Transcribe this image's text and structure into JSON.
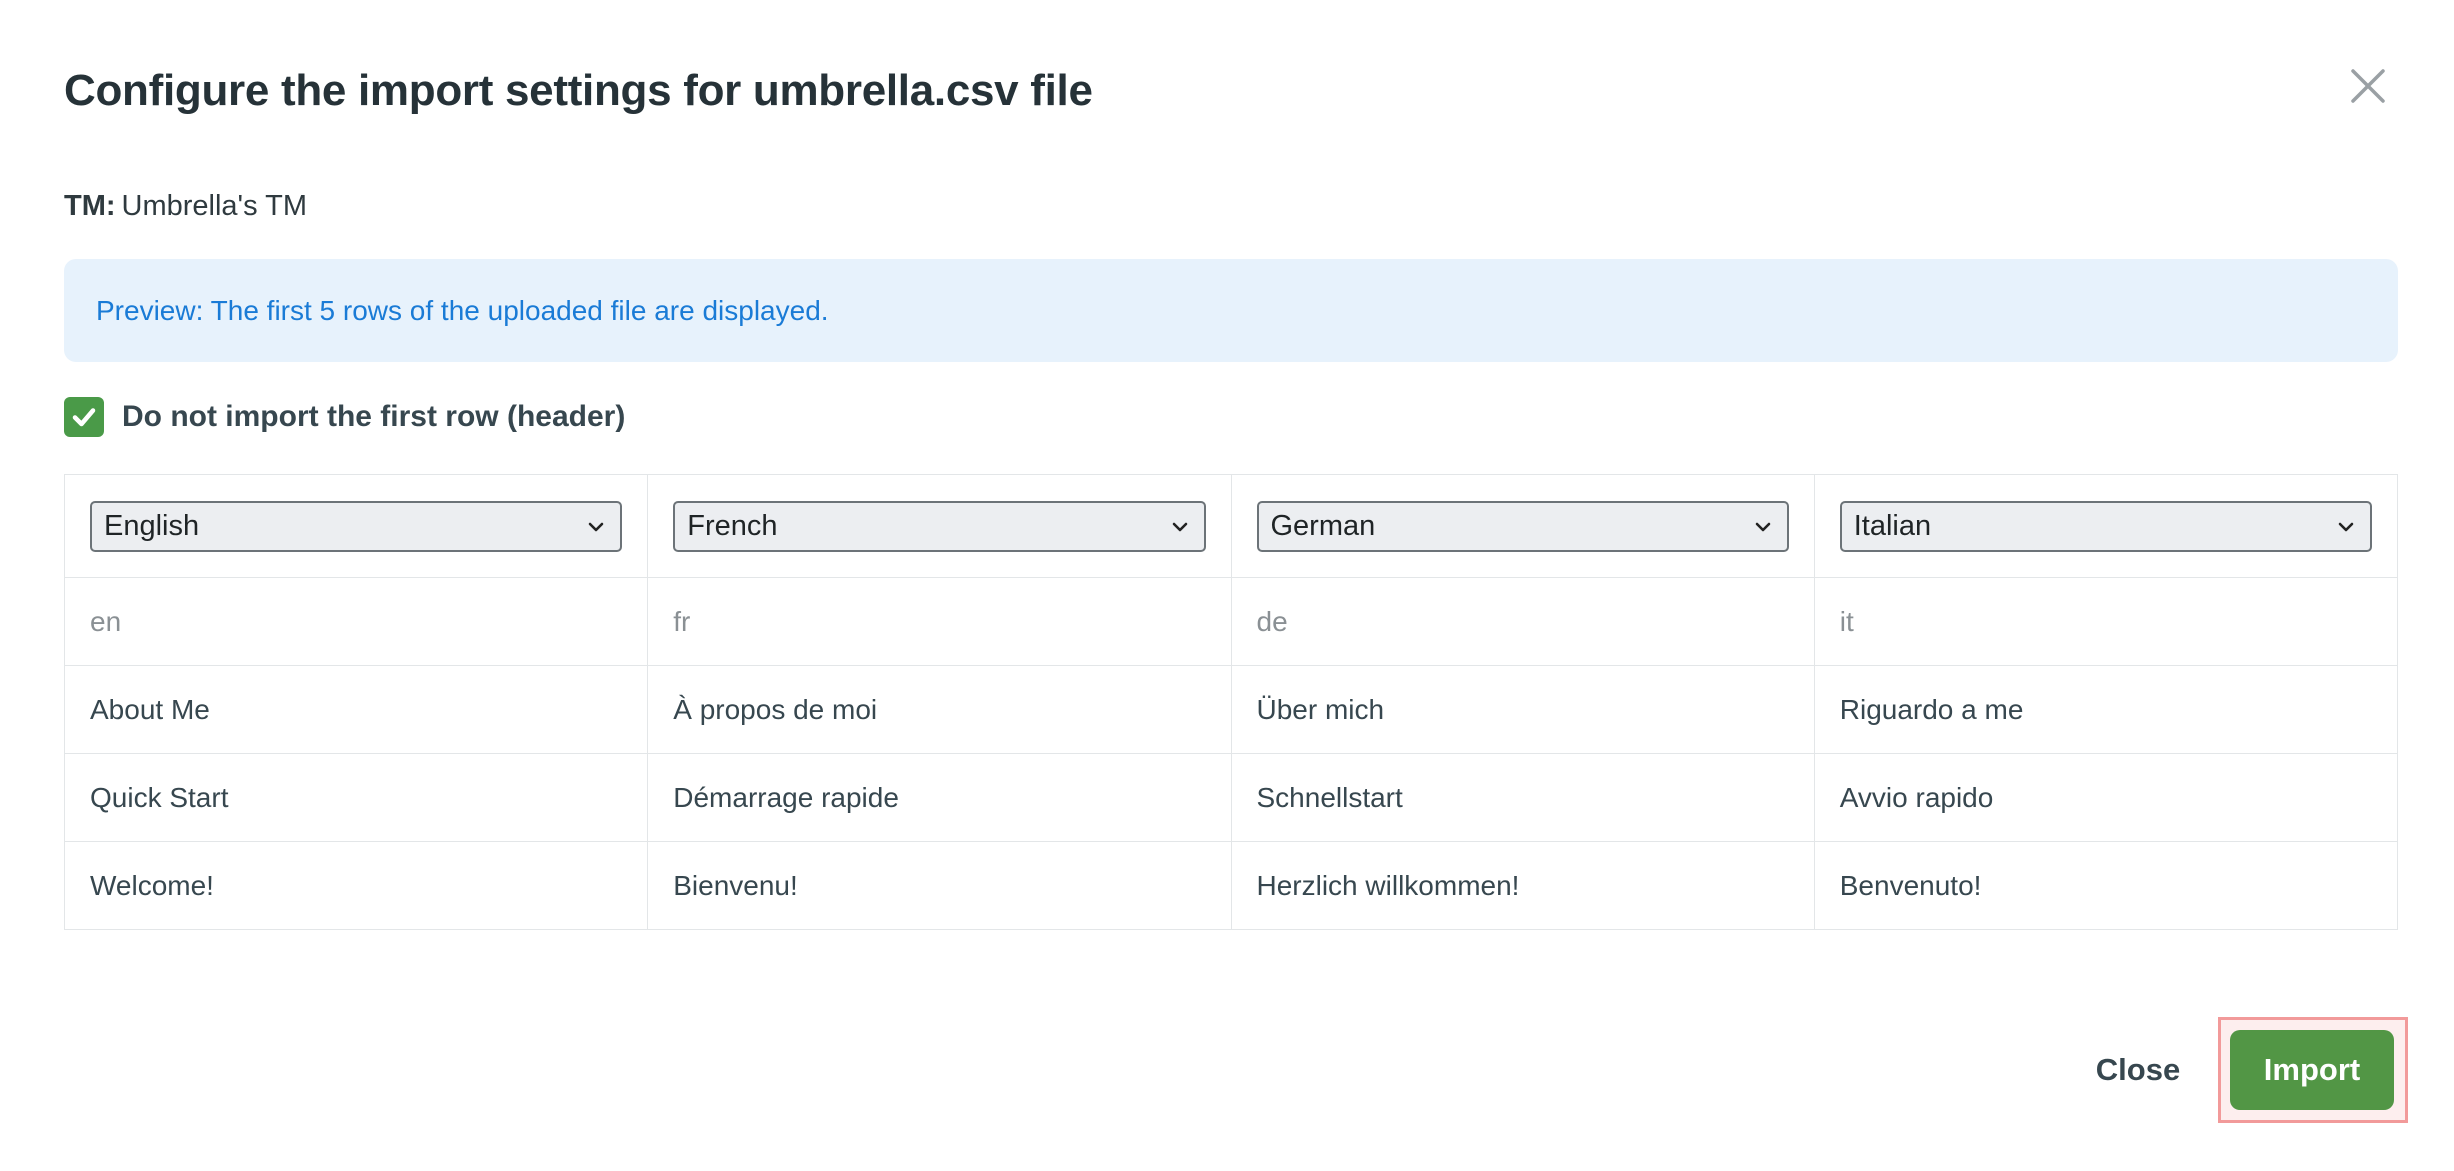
{
  "dialog": {
    "title": "Configure the import settings for umbrella.csv file",
    "close_icon": "close-icon"
  },
  "tm": {
    "label": "TM:",
    "value": "Umbrella's TM"
  },
  "notice": {
    "text": "Preview: The first 5 rows of the uploaded file are displayed."
  },
  "header_option": {
    "checked": true,
    "label": "Do not import the first row (header)"
  },
  "columns": [
    {
      "language": "English"
    },
    {
      "language": "French"
    },
    {
      "language": "German"
    },
    {
      "language": "Italian"
    }
  ],
  "rows": [
    [
      "en",
      "fr",
      "de",
      "it"
    ],
    [
      "About Me",
      "À propos de moi",
      "Über mich",
      "Riguardo a me"
    ],
    [
      "Quick Start",
      "Démarrage rapide",
      "Schnellstart",
      "Avvio rapido"
    ],
    [
      "Welcome!",
      "Bienvenu!",
      "Herzlich willkommen!",
      "Benvenuto!"
    ]
  ],
  "footer": {
    "close_label": "Close",
    "import_label": "Import"
  },
  "colors": {
    "accent_green": "#529645",
    "notice_bg": "#e7f2fc",
    "notice_text": "#1a7bd6"
  }
}
